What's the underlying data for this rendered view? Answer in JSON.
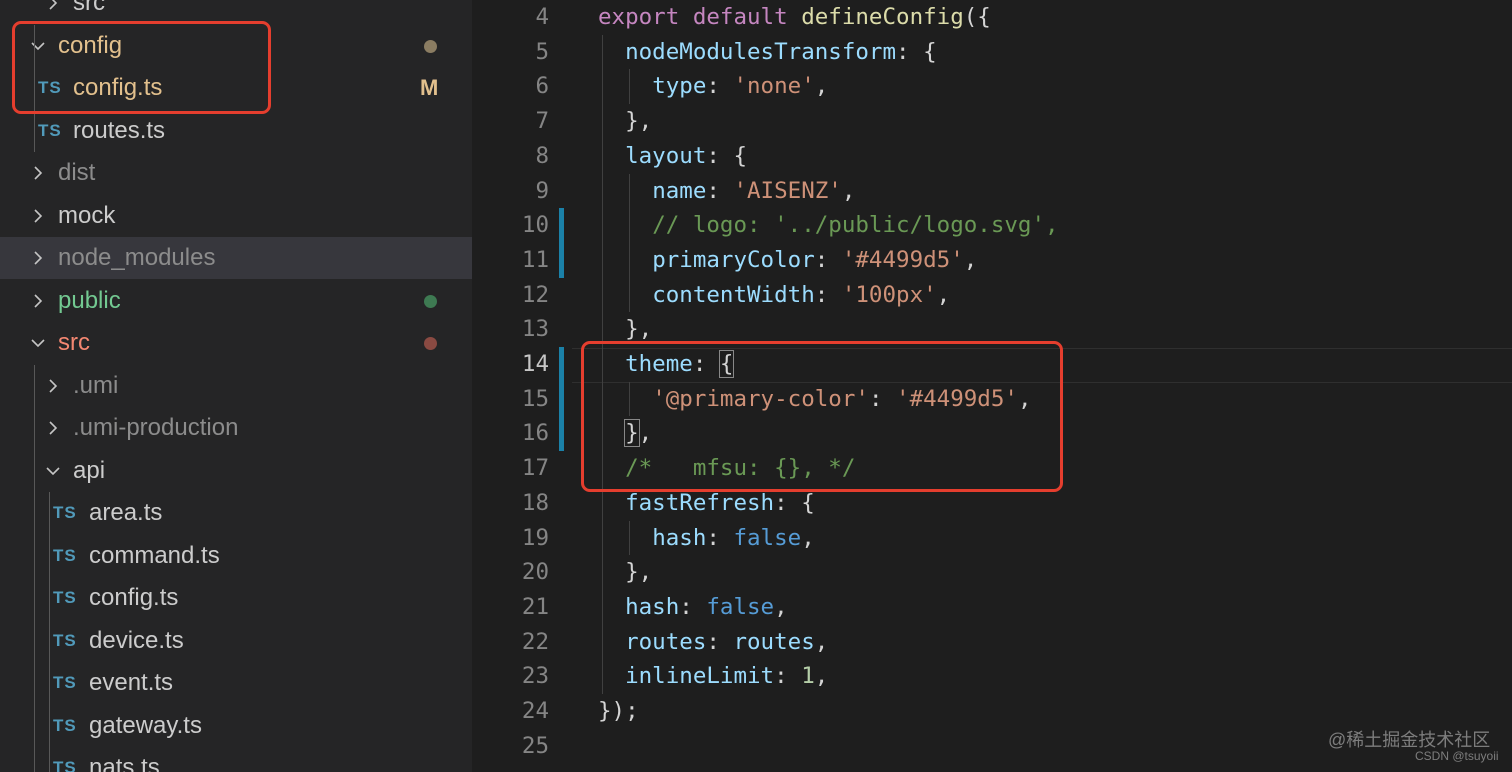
{
  "explorer": {
    "rows": [
      {
        "label": "src",
        "kind": "folder",
        "state": "collapsed",
        "depth": 1,
        "color": "#cccccc"
      },
      {
        "label": "config",
        "kind": "folder",
        "state": "expanded",
        "depth": 0,
        "color": "#e2c08d",
        "badge": "dot",
        "badge_color": "#8b7d62"
      },
      {
        "label": "config.ts",
        "kind": "file",
        "depth": 0,
        "color": "#e2c08d",
        "icon": "TS",
        "badge": "M",
        "badge_color": "#e2c08d"
      },
      {
        "label": "routes.ts",
        "kind": "file",
        "depth": 0,
        "color": "#cccccc",
        "icon": "TS"
      },
      {
        "label": "dist",
        "kind": "folder",
        "state": "collapsed",
        "depth": 0,
        "color": "#8c8c8c"
      },
      {
        "label": "mock",
        "kind": "folder",
        "state": "collapsed",
        "depth": 0,
        "color": "#cccccc"
      },
      {
        "label": "node_modules",
        "kind": "folder",
        "state": "collapsed",
        "depth": 0,
        "color": "#8c8c8c",
        "selected": true
      },
      {
        "label": "public",
        "kind": "folder",
        "state": "collapsed",
        "depth": 0,
        "color": "#73c991",
        "badge": "dot",
        "badge_color": "#3e7a52"
      },
      {
        "label": "src",
        "kind": "folder",
        "state": "expanded",
        "depth": 0,
        "color": "#f48771",
        "badge": "dot",
        "badge_color": "#8a4a42"
      },
      {
        "label": ".umi",
        "kind": "folder",
        "state": "collapsed",
        "depth": 1,
        "color": "#8c8c8c"
      },
      {
        "label": ".umi-production",
        "kind": "folder",
        "state": "collapsed",
        "depth": 1,
        "color": "#8c8c8c"
      },
      {
        "label": "api",
        "kind": "folder",
        "state": "expanded",
        "depth": 1,
        "color": "#cccccc"
      },
      {
        "label": "area.ts",
        "kind": "file",
        "depth": 1,
        "color": "#cccccc",
        "icon": "TS"
      },
      {
        "label": "command.ts",
        "kind": "file",
        "depth": 1,
        "color": "#cccccc",
        "icon": "TS"
      },
      {
        "label": "config.ts",
        "kind": "file",
        "depth": 1,
        "color": "#cccccc",
        "icon": "TS"
      },
      {
        "label": "device.ts",
        "kind": "file",
        "depth": 1,
        "color": "#cccccc",
        "icon": "TS"
      },
      {
        "label": "event.ts",
        "kind": "file",
        "depth": 1,
        "color": "#cccccc",
        "icon": "TS"
      },
      {
        "label": "gateway.ts",
        "kind": "file",
        "depth": 1,
        "color": "#cccccc",
        "icon": "TS"
      },
      {
        "label": "nats.ts",
        "kind": "file",
        "depth": 1,
        "color": "#cccccc",
        "icon": "TS"
      }
    ]
  },
  "editor": {
    "active_line": 14,
    "modified_line_ranges": [
      [
        10,
        11
      ],
      [
        14,
        16
      ]
    ],
    "lines": [
      {
        "n": "4",
        "tokens": [
          [
            "export",
            "kw"
          ],
          [
            " ",
            "punc"
          ],
          [
            "default",
            "kw"
          ],
          [
            " ",
            "punc"
          ],
          [
            "defineConfig",
            "fn"
          ],
          [
            "({",
            "punc"
          ]
        ]
      },
      {
        "n": "5",
        "tokens": [
          [
            "  ",
            "punc"
          ],
          [
            "nodeModulesTransform",
            "prop"
          ],
          [
            ": {",
            "punc"
          ]
        ]
      },
      {
        "n": "6",
        "tokens": [
          [
            "    ",
            "punc"
          ],
          [
            "type",
            "prop"
          ],
          [
            ": ",
            "punc"
          ],
          [
            "'none'",
            "str"
          ],
          [
            ",",
            "punc"
          ]
        ]
      },
      {
        "n": "7",
        "tokens": [
          [
            "  ",
            "punc"
          ],
          [
            "},",
            "punc"
          ]
        ]
      },
      {
        "n": "8",
        "tokens": [
          [
            "  ",
            "punc"
          ],
          [
            "layout",
            "prop"
          ],
          [
            ": {",
            "punc"
          ]
        ]
      },
      {
        "n": "9",
        "tokens": [
          [
            "    ",
            "punc"
          ],
          [
            "name",
            "prop"
          ],
          [
            ": ",
            "punc"
          ],
          [
            "'AISENZ'",
            "str"
          ],
          [
            ",",
            "punc"
          ]
        ]
      },
      {
        "n": "10",
        "tokens": [
          [
            "    ",
            "punc"
          ],
          [
            "// logo: '../public/logo.svg',",
            "cmt"
          ]
        ]
      },
      {
        "n": "11",
        "tokens": [
          [
            "    ",
            "punc"
          ],
          [
            "primaryColor",
            "prop"
          ],
          [
            ": ",
            "punc"
          ],
          [
            "'#4499d5'",
            "str"
          ],
          [
            ",",
            "punc"
          ]
        ]
      },
      {
        "n": "12",
        "tokens": [
          [
            "    ",
            "punc"
          ],
          [
            "contentWidth",
            "prop"
          ],
          [
            ": ",
            "punc"
          ],
          [
            "'100px'",
            "str"
          ],
          [
            ",",
            "punc"
          ]
        ]
      },
      {
        "n": "13",
        "tokens": [
          [
            "  ",
            "punc"
          ],
          [
            "},",
            "punc"
          ]
        ]
      },
      {
        "n": "14",
        "tokens": [
          [
            "  ",
            "punc"
          ],
          [
            "theme",
            "prop"
          ],
          [
            ": ",
            "punc"
          ],
          [
            "{",
            "brkhl"
          ]
        ]
      },
      {
        "n": "15",
        "tokens": [
          [
            "    ",
            "punc"
          ],
          [
            "'@primary-color'",
            "str"
          ],
          [
            ": ",
            "punc"
          ],
          [
            "'#4499d5'",
            "str"
          ],
          [
            ",",
            "punc"
          ]
        ]
      },
      {
        "n": "16",
        "tokens": [
          [
            "  ",
            "punc"
          ],
          [
            "}",
            "brkhl"
          ],
          [
            ",",
            "punc"
          ]
        ]
      },
      {
        "n": "17",
        "tokens": [
          [
            "  ",
            "punc"
          ],
          [
            "/*   mfsu: {}, */",
            "cmt"
          ]
        ]
      },
      {
        "n": "18",
        "tokens": [
          [
            "  ",
            "punc"
          ],
          [
            "fastRefresh",
            "prop"
          ],
          [
            ": {",
            "punc"
          ]
        ]
      },
      {
        "n": "19",
        "tokens": [
          [
            "    ",
            "punc"
          ],
          [
            "hash",
            "prop"
          ],
          [
            ": ",
            "punc"
          ],
          [
            "false",
            "kw2"
          ],
          [
            ",",
            "punc"
          ]
        ]
      },
      {
        "n": "20",
        "tokens": [
          [
            "  ",
            "punc"
          ],
          [
            "},",
            "punc"
          ]
        ]
      },
      {
        "n": "21",
        "tokens": [
          [
            "  ",
            "punc"
          ],
          [
            "hash",
            "prop"
          ],
          [
            ": ",
            "punc"
          ],
          [
            "false",
            "kw2"
          ],
          [
            ",",
            "punc"
          ]
        ]
      },
      {
        "n": "22",
        "tokens": [
          [
            "  ",
            "punc"
          ],
          [
            "routes",
            "prop"
          ],
          [
            ": ",
            "punc"
          ],
          [
            "routes",
            "prop"
          ],
          [
            ",",
            "punc"
          ]
        ]
      },
      {
        "n": "23",
        "tokens": [
          [
            "  ",
            "punc"
          ],
          [
            "inlineLimit",
            "prop"
          ],
          [
            ": ",
            "punc"
          ],
          [
            "1",
            "num"
          ],
          [
            ",",
            "punc"
          ]
        ]
      },
      {
        "n": "24",
        "tokens": [
          [
            "});",
            "punc"
          ]
        ]
      },
      {
        "n": "25",
        "tokens": []
      }
    ]
  },
  "watermark": {
    "site": "@稀土掘金技术社区",
    "author": "CSDN @tsuyoii"
  },
  "colors": {
    "annotation_box": "#e53e2e",
    "gutter_modified": "#1b81a8",
    "ts_icon": "#519aba"
  }
}
